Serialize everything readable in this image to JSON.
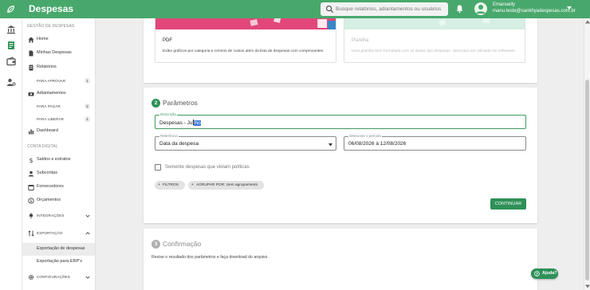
{
  "header": {
    "title": "Despesas",
    "search_placeholder": "Busque relatórios, adiantamentos ou usuários",
    "user_name": "Emanuelly",
    "user_email": "manu.teste@sankhyadespesas.com.br"
  },
  "sidebar": {
    "section_gestao": "GESTÃO DE DESPESAS",
    "section_conta": "CONTA DIGITAL",
    "items": {
      "home": "Home",
      "minhas_despesas": "Minhas Despesas",
      "relatorios": "Relatórios",
      "para_aprovar": "PARA APROVAR",
      "para_aprovar_count": "1",
      "adiantamentos": "Adiantamentos",
      "para_pagar": "PARA PAGAR",
      "para_pagar_count": "2",
      "para_liberar": "PARA LIBERAR",
      "para_liberar_count": "1",
      "dashboard": "Dashboard",
      "saldos": "Saldos e extratos",
      "subcontas": "Subcontas",
      "fornecedores": "Fornecedores",
      "orcamentos": "Orçamentos",
      "integracoes": "INTEGRAÇÕES",
      "exportacao": "EXPORTAÇÃO",
      "exportacao_despesas": "Exportação de despesas",
      "exportacao_erps": "Exportação para ERP's",
      "configuracoes": "CONFIGURAÇÕES"
    }
  },
  "export_options": {
    "pdf": {
      "title": "PDF",
      "description": "Exibe gráficos por categoria e centros de custos além da lista de despesas com comprovantes."
    },
    "sheet": {
      "title": "Planilha",
      "description": "Uma planilha bem formatada com os dados das despesas. Ideal para ser utilizada em softwares."
    }
  },
  "parameters": {
    "step_number": "2",
    "title": "Parâmetros",
    "description_label": "Descrição",
    "description_value_before": "Despesas - Ju",
    "description_value_selected": "lho",
    "reference_label": "Referência",
    "reference_value": "Data da despesa",
    "period_label": "Selecione o período",
    "period_value": "06/08/2026 à 12/08/2026",
    "checkbox_label": "Somente despesas que violam políticas",
    "checkbox_checked": false,
    "chip_filters": "FILTROS",
    "chip_group": "AGRUPAR POR: Sem agrupamento",
    "continue_label": "CONTINUAR"
  },
  "confirmation": {
    "step_number": "3",
    "title": "Confirmação",
    "description": "Revise o resultado dos parâmetros e faça download do arquivo."
  },
  "help": {
    "label": "Ajuda?"
  },
  "colors": {
    "brand_green": "#48a86c",
    "button_green": "#2e9158",
    "pdf_banner": "#e1477a",
    "sheet_banner": "#d5efe4",
    "step_active": "#2e9158",
    "step_inactive": "#b0b0b0"
  },
  "icons": [
    "logo-icon",
    "search-icon",
    "bell-icon",
    "avatar-icon",
    "caret-down-icon"
  ]
}
